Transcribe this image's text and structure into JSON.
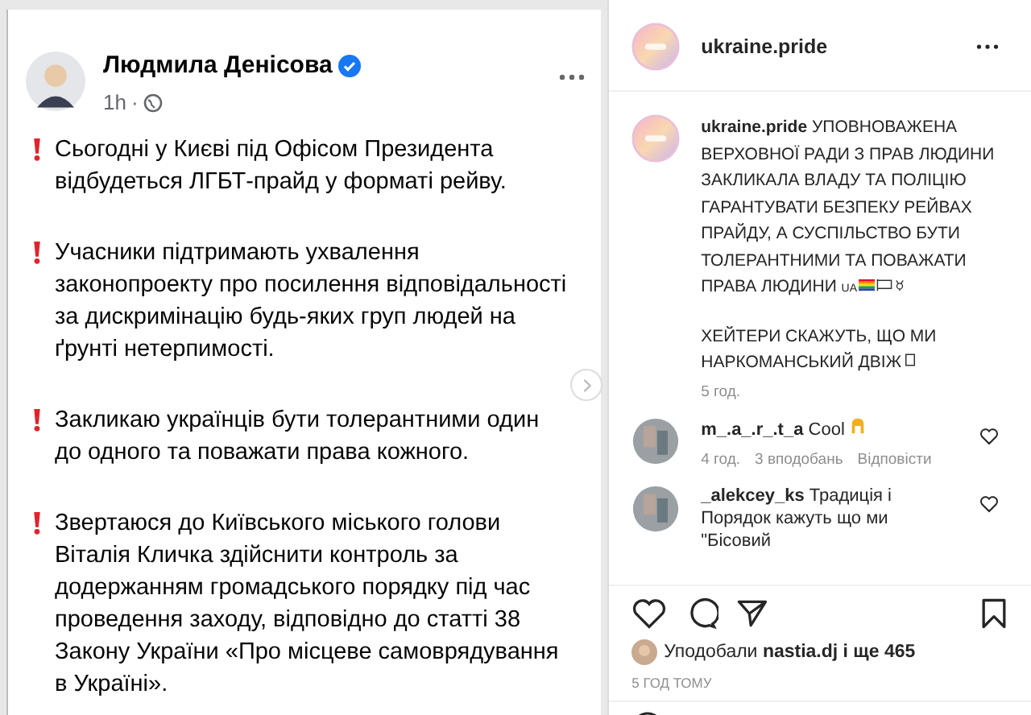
{
  "facebook_post": {
    "author": "Людмила Денісова",
    "verified": true,
    "time": "1h",
    "separator": "·",
    "paragraphs": [
      "Сьогодні у Києві під Офісом Президента відбудеться ЛГБТ-прайд у форматі рейву.",
      "Учасники підтримають ухвалення законопроекту про посилення відповідальності за дискримінацію будь-яких груп людей на ґрунті нетерпимості.",
      "Закликаю українців бути толерантними один до одного та поважати права кожного.",
      "Звертаюся до Київського міського голови Віталія Кличка здійснити контроль за додержанням громадського порядку під час проведення заходу, відповідно до статті 38 Закону України «Про місцеве самоврядування в Україні»."
    ]
  },
  "instagram_post": {
    "username": "ukraine.pride",
    "caption": {
      "username": "ukraine.pride",
      "text": "УПОВНОВАЖЕНА ВЕРХОВНОЇ РАДИ З ПРАВ ЛЮДИНИ ЗАКЛИКАЛА ВЛАДУ ТА ПОЛІЦІЮ ГАРАНТУВАТИ БЕЗПЕКУ РЕЙВАХ ПРАЙДУ, А СУСПІЛЬСТВО БУТИ ТОЛЕРАНТНИМИ ТА ПОВАЖАТИ ПРАВА ЛЮДИНИ",
      "flag_text": "UA",
      "second_text": "ХЕЙТЕРИ СКАЖУТЬ, ЩО МИ НАРКОМАНСЬКИЙ ДВІЖ",
      "time": "5 год."
    },
    "comments": [
      {
        "username": "m_.a_.r_.t_a",
        "text": "Cool",
        "time": "4 год.",
        "likes": "3 вподобань",
        "reply": "Відповісти"
      },
      {
        "username": "_alekcey_ks",
        "text": "Традиція і Порядок кажуть що ми \"Бісовий"
      }
    ],
    "likes": {
      "prefix": "Уподобали",
      "user": "nastia.dj",
      "suffix": "і ще 465"
    },
    "timestamp": "5 ГОД ТОМУ"
  }
}
